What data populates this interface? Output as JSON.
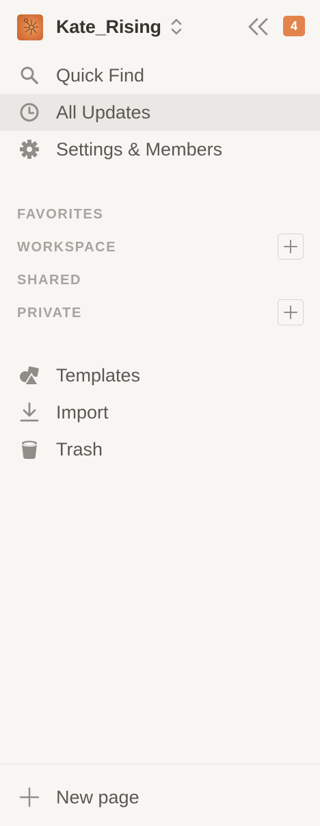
{
  "workspace": {
    "name": "Kate_Rising",
    "avatar_icon": "workspace-avatar",
    "switcher_icon": "chevron-up-down-icon",
    "collapse_icon": "double-chevron-left-icon",
    "badge_count": "4",
    "badge_color": "#e3844c"
  },
  "nav": {
    "quick_find": "Quick Find",
    "all_updates": "All Updates",
    "settings": "Settings & Members"
  },
  "sections": {
    "favorites": "FAVORITES",
    "workspace": "WORKSPACE",
    "shared": "SHARED",
    "private": "PRIVATE"
  },
  "tools": {
    "templates": "Templates",
    "import": "Import",
    "trash": "Trash"
  },
  "footer": {
    "new_page": "New page"
  },
  "colors": {
    "background": "#f7f6f3",
    "active_row": "#e9e8e4",
    "text": "#37352f",
    "muted_text": "#a5a49f"
  }
}
